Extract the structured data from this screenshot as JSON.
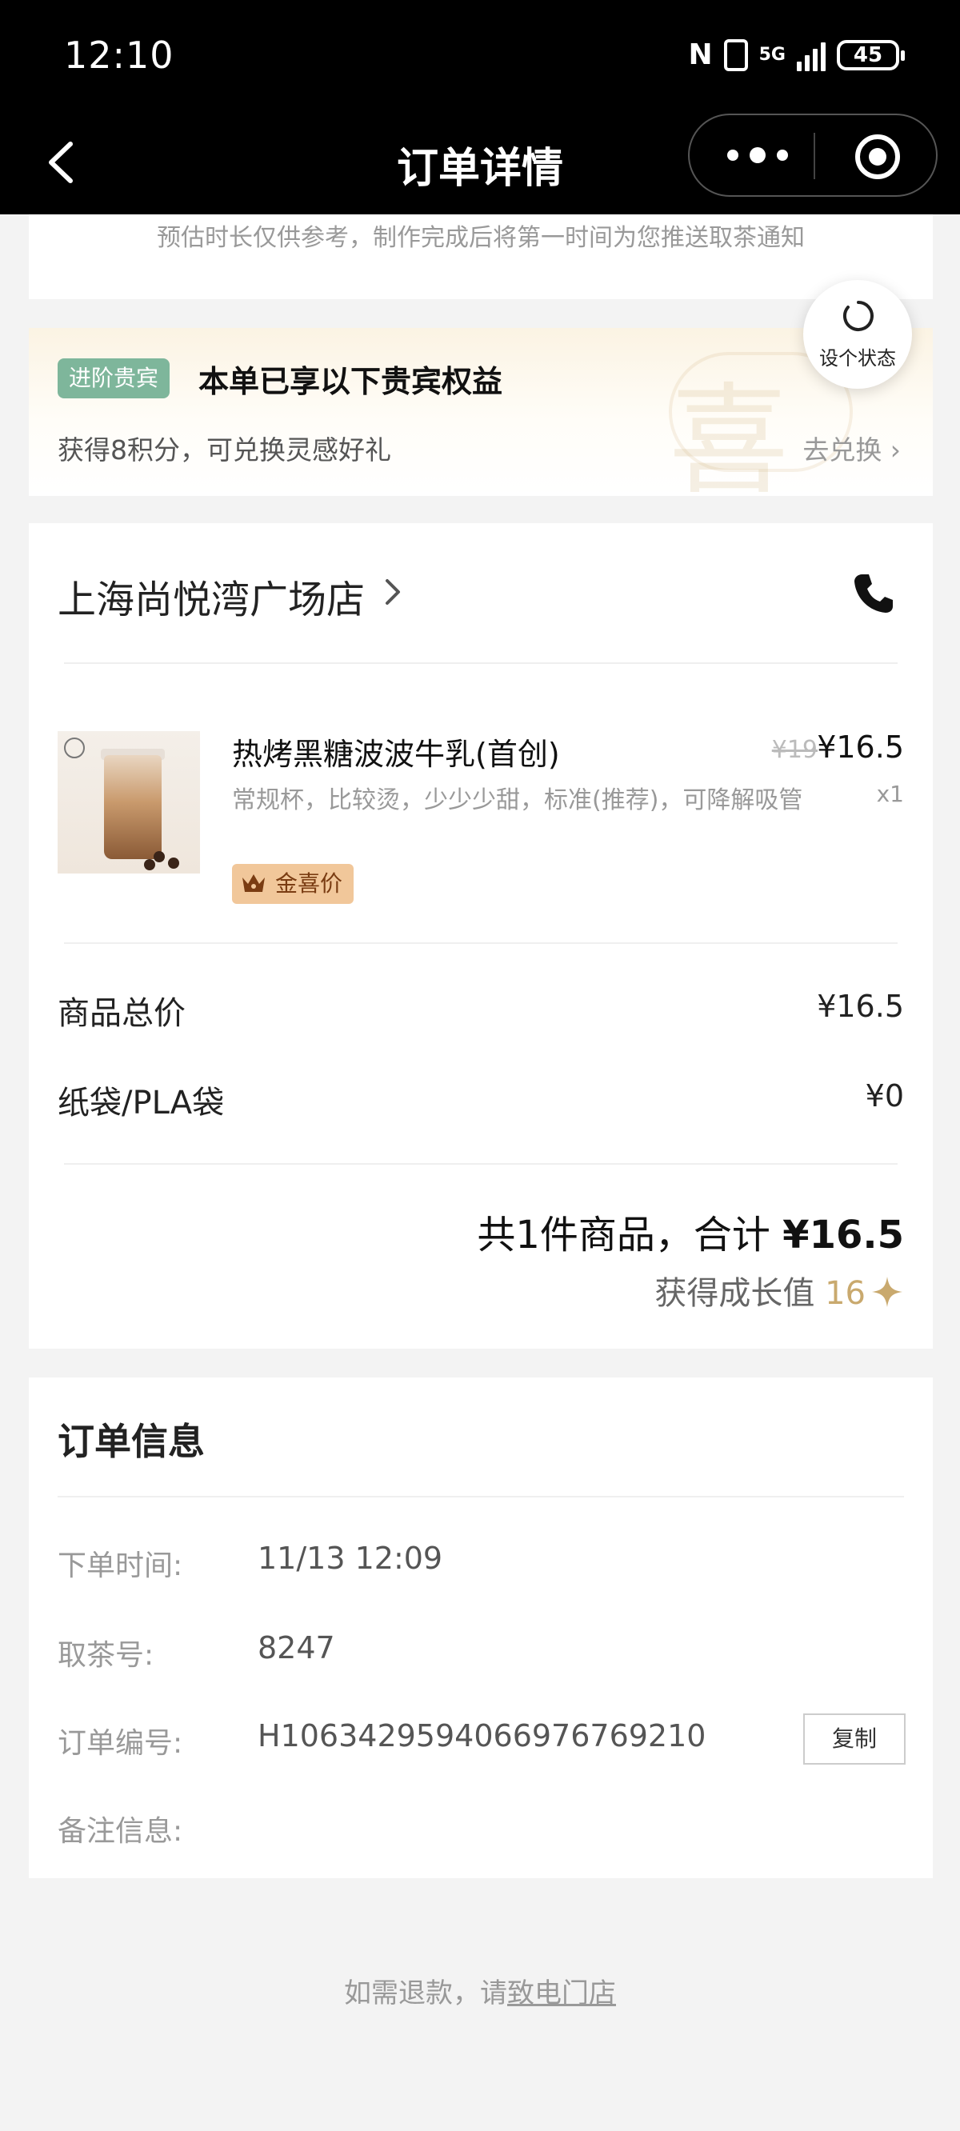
{
  "status_bar": {
    "time": "12:10",
    "nfc": "N",
    "network": "5G",
    "battery": "45"
  },
  "nav": {
    "title": "订单详情",
    "back_icon": "chevron-left-icon",
    "more_icon": "more-dots-icon",
    "close_icon": "target-icon"
  },
  "estimate_note": "预估时长仅供参考，制作完成后将第一时间为您推送取茶通知",
  "vip": {
    "tag": "进阶贵宾",
    "title": "本单已享以下贵宾权益",
    "points_text": "获得8积分，可兑换灵感好礼",
    "redeem_label": "去兑换 ›",
    "watermark": "喜"
  },
  "status_bubble": {
    "label": "设个状态"
  },
  "store": {
    "name": "上海尚悦湾广场店"
  },
  "product": {
    "name": "热烤黑糖波波牛乳(首创)",
    "options": "常规杯，比较烫，少少少甜，标准(推荐)，可降解吸管",
    "original_price": "¥19",
    "price": "¥16.5",
    "quantity": "x1",
    "tag": "金喜价"
  },
  "summary": {
    "goods_total_label": "商品总价",
    "goods_total_value": "¥16.5",
    "bag_label": "纸袋/PLA袋",
    "bag_value": "¥0",
    "total_text_prefix": "共1件商品，合计 ",
    "total_value": "¥16.5",
    "growth_label": "获得成长值 ",
    "growth_value": "16"
  },
  "order_info": {
    "title": "订单信息",
    "order_time_label": "下单时间:",
    "order_time_value": "11/13 12:09",
    "pickup_label": "取茶号:",
    "pickup_value": "8247",
    "order_no_label": "订单编号:",
    "order_no_value": "H1063429594066976769210",
    "copy_label": "复制",
    "remark_label": "备注信息:"
  },
  "refund": {
    "prefix": "如需退款，请",
    "link": "致电门店"
  },
  "colors": {
    "vip_tag": "#7eb69b",
    "gold_tag": "#f1c79a",
    "growth": "#c9a96e",
    "navbar": "#000000"
  }
}
